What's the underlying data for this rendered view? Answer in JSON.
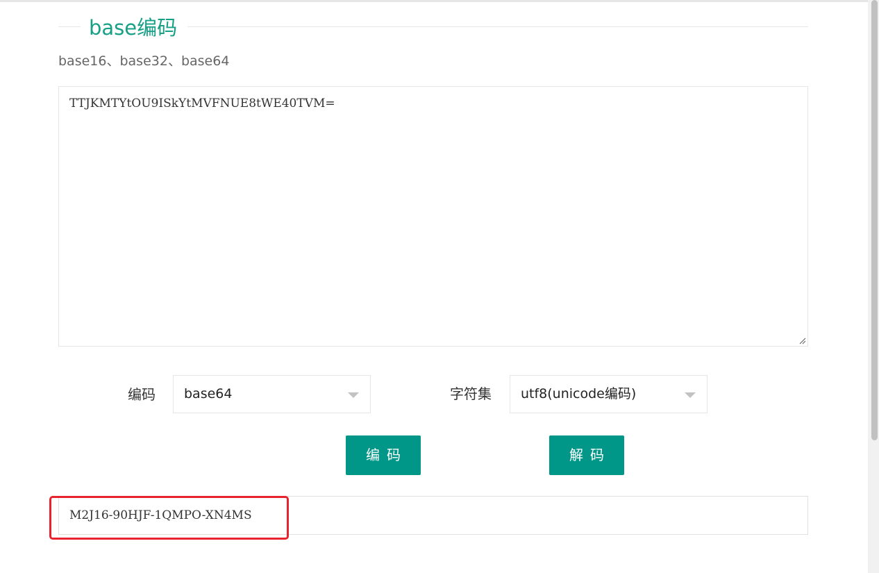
{
  "section": {
    "title": "base编码",
    "subtitle": "base16、base32、base64"
  },
  "input": {
    "value": "TTJKMTYtOU9ISkYtMVFNUE8tWE40TVM="
  },
  "encoding": {
    "label": "编码",
    "selected": "base64"
  },
  "charset": {
    "label": "字符集",
    "selected": "utf8(unicode编码)"
  },
  "buttons": {
    "encode": "编码",
    "decode": "解码"
  },
  "output": {
    "value": "M2J16-90HJF-1QMPO-XN4MS"
  },
  "colors": {
    "accent": "#16a085",
    "button": "#009688",
    "highlight": "#e8232d"
  }
}
